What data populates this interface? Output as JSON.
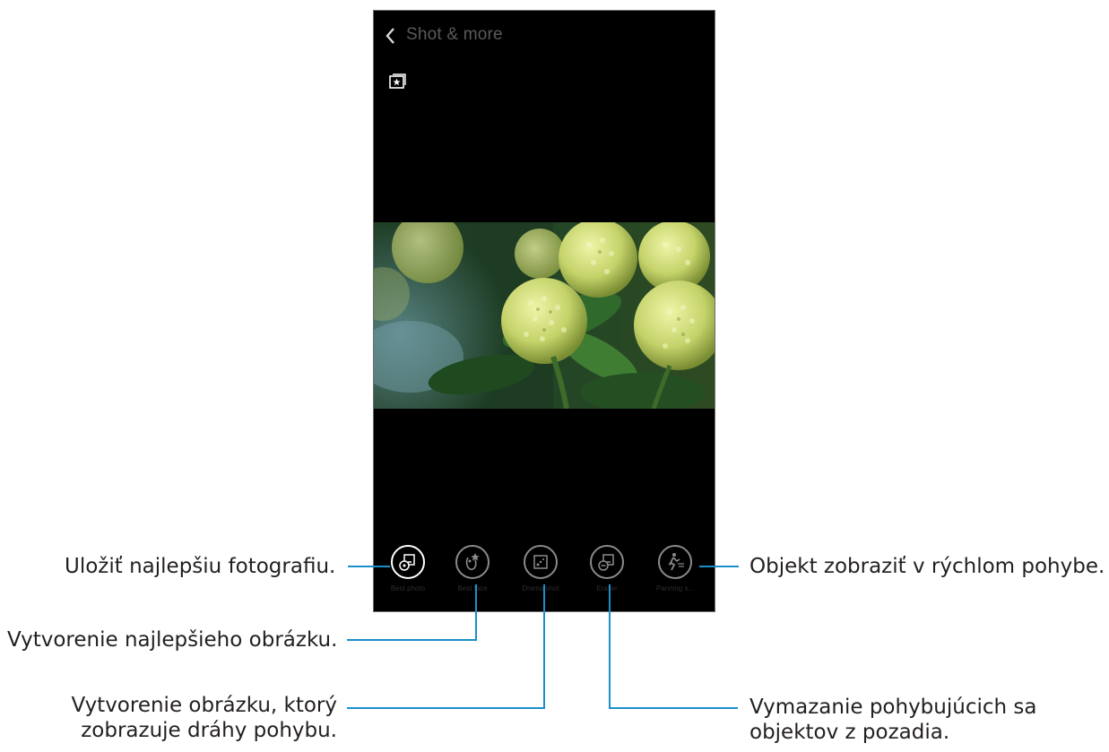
{
  "header": {
    "title": "Shot & more"
  },
  "icons": {
    "back": "chevron-left-icon",
    "album": "star-album-icon"
  },
  "modes": [
    {
      "label": "Best photo",
      "icon": "best-photo-icon"
    },
    {
      "label": "Best face",
      "icon": "best-face-icon"
    },
    {
      "label": "Drama shot",
      "icon": "drama-shot-icon"
    },
    {
      "label": "Eraser",
      "icon": "eraser-icon"
    },
    {
      "label": "Panning s...",
      "icon": "panning-shot-icon"
    }
  ],
  "callouts": {
    "best_photo": "Uložiť najlepšiu fotografiu.",
    "panning": "Objekt zobraziť v rýchlom pohybe.",
    "best_face": "Vytvorenie najlepšieho obrázku.",
    "drama_line1": "Vytvorenie obrázku, ktorý",
    "drama_line2": "zobrazuje dráhy pohybu.",
    "eraser_line1": "Vymazanie pohybujúcich sa",
    "eraser_line2": "objektov z pozadia."
  },
  "colors": {
    "leader_line": "#1a8fc9",
    "screen_bg": "#000000"
  }
}
